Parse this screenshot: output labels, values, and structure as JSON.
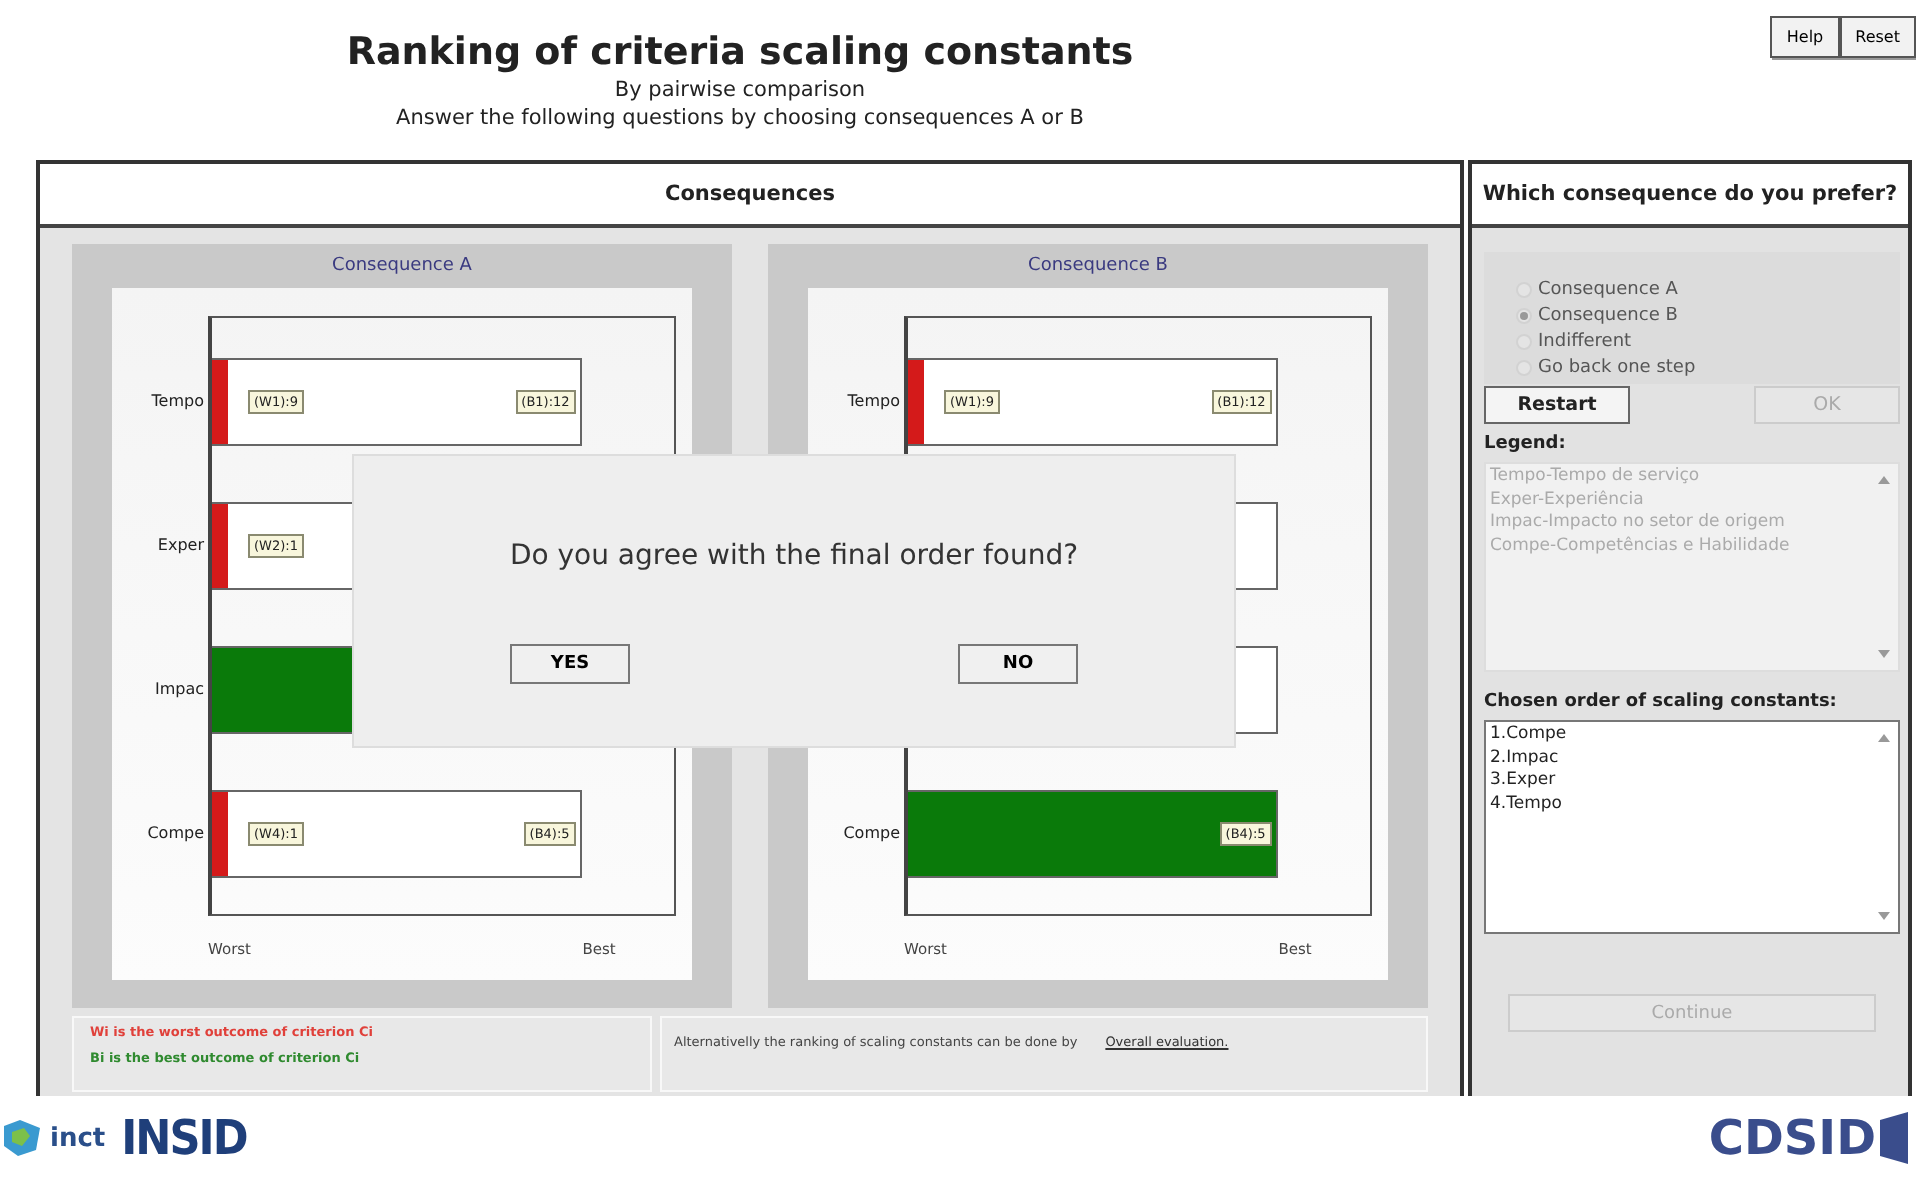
{
  "title": "Ranking of criteria scaling constants",
  "subtitle": "By pairwise comparison",
  "instruction": "Answer the following questions by choosing consequences A or B",
  "header_buttons": [
    "Help",
    "Reset"
  ],
  "consequences_panel": {
    "title": "Consequences",
    "charts": [
      {
        "title": "Consequence A",
        "worst": "Worst",
        "best": "Best",
        "bars": [
          {
            "kind": "bar",
            "criterion": "Tempo",
            "level": 0,
            "worst_label": "(W1):9",
            "best_label": "(B1):12"
          },
          {
            "kind": "bar",
            "criterion": "Exper",
            "level": 0,
            "worst_label": "(W2):1"
          },
          {
            "kind": "bar",
            "criterion": "Impac",
            "level": 1
          },
          {
            "kind": "bar",
            "criterion": "Compe",
            "level": 0,
            "worst_label": "(W4):1",
            "best_label": "(B4):5"
          }
        ]
      },
      {
        "title": "Consequence B",
        "worst": "Worst",
        "best": "Best",
        "bars": [
          {
            "kind": "bar",
            "criterion": "Tempo",
            "level": 0,
            "worst_label": "(W1):9",
            "best_label": "(B1):12"
          },
          {
            "kind": "covered"
          },
          {
            "kind": "covered"
          },
          {
            "kind": "bar",
            "criterion": "Compe",
            "level": 1,
            "best_label": "(B4):5"
          }
        ]
      }
    ]
  },
  "notes": [
    {
      "text": "Wi is the worst outcome of criterion Ci",
      "color": "#e0403a"
    },
    {
      "text": "Bi is the best outcome of criterion Ci",
      "color": "#2f8a2f"
    }
  ],
  "alternative": {
    "text": "Alternativelly the ranking of scaling constants can be done by",
    "link": "Overall evaluation."
  },
  "dialog": {
    "question": "Do you agree with the final order found?",
    "buttons": [
      "YES",
      "NO"
    ]
  },
  "preference_panel": {
    "title": "Which consequence do you prefer?",
    "options_disabled": true,
    "options": [
      {
        "label": "Consequence A",
        "selected": false
      },
      {
        "label": "Consequence B",
        "selected": true
      },
      {
        "label": "Indifferent",
        "selected": false
      },
      {
        "label": "Go back one step",
        "selected": false
      }
    ],
    "restart": {
      "label": "Restart",
      "disabled": false
    },
    "ok": {
      "label": "OK",
      "disabled": true
    },
    "legend_label": "Legend:",
    "legend_disabled": true,
    "legend_lines": [
      "Tempo-Tempo de serviço",
      "Exper-Experiência",
      "Impac-Impacto no setor de origem",
      "Compe-Competências e Habilidade"
    ],
    "order_label": "Chosen order of scaling constants:",
    "order": [
      "1.Compe",
      "2.Impac",
      "3.Exper",
      "4.Tempo"
    ],
    "continue": {
      "label": "Continue",
      "disabled": true
    }
  },
  "logos": [
    "inct",
    "INSID",
    "CDSID"
  ]
}
